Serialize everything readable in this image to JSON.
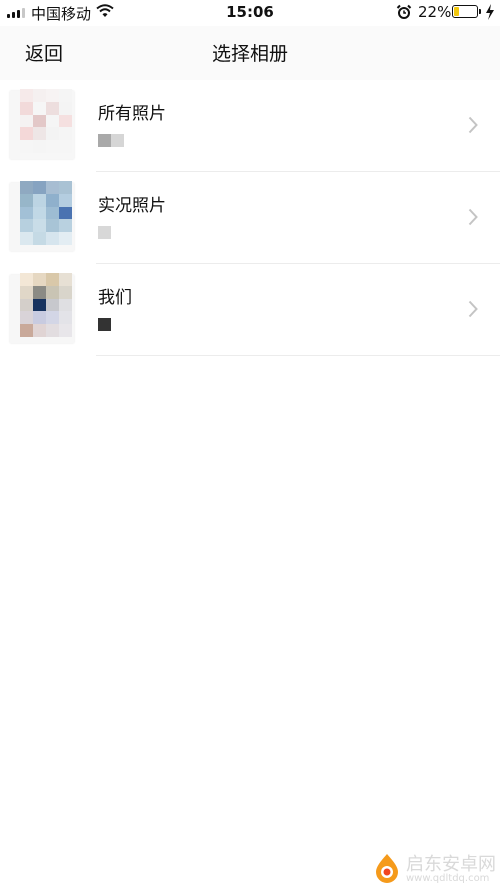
{
  "status_bar": {
    "carrier": "中国移动",
    "time": "15:06",
    "battery_percent": "22%",
    "battery_level": 0.22,
    "battery_color": "#f2c80f",
    "icons": [
      "signal-icon",
      "wifi-icon",
      "alarm-icon",
      "battery-icon",
      "charging-icon"
    ]
  },
  "nav": {
    "back_label": "返回",
    "title": "选择相册"
  },
  "albums": [
    {
      "name": "所有照片",
      "tiles": [
        "#f6eaea",
        "#f5f0f0",
        "#f7f3f3",
        "#f5f5f5",
        "#f2dada",
        "#f6f6f6",
        "#eddede",
        "#f4f4f4",
        "#f5f2f2",
        "#e3c8c8",
        "#f5f5f5",
        "#f5e0e0",
        "#f4d8d8",
        "#eee6e6",
        "#f3f3f3",
        "#f5f5f5",
        "#f6f6f6",
        "#f5f5f5",
        "#f6f6f6",
        "#f6f6f6"
      ],
      "count_tiles": [
        "#a9a9a9",
        "#d6d6d6"
      ]
    },
    {
      "name": "实况照片",
      "tiles": [
        "#8fa9c1",
        "#86a3c1",
        "#a7bdd2",
        "#a9c2d4",
        "#97b6c9",
        "#bcd4e3",
        "#8fb0cc",
        "#b4cde0",
        "#a2c0d6",
        "#c1d8e6",
        "#9dbcd3",
        "#4a73b1",
        "#b7d0df",
        "#c9dde8",
        "#a8c4d6",
        "#b9d1e0",
        "#dbe8ef",
        "#c5dae5",
        "#d6e5ee",
        "#e3edf3"
      ],
      "count_tiles": [
        "#d8d8d8"
      ]
    },
    {
      "name": "我们",
      "tiles": [
        "#f3e7d6",
        "#e6d8c2",
        "#d9c8a9",
        "#e7e0d4",
        "#e0d7c8",
        "#8b8b85",
        "#c9c4b4",
        "#d9d5cb",
        "#d4cfca",
        "#17335f",
        "#c7c8cd",
        "#dfdfe2",
        "#d9d3d8",
        "#c8cbe0",
        "#d3d6e6",
        "#e3e3e8",
        "#c9a99a",
        "#e0d4d4",
        "#e2dde0",
        "#e8e6ea"
      ],
      "count_tiles": [
        "#333333"
      ]
    }
  ],
  "watermark": {
    "title": "启东安卓网",
    "url": "www.qdltdq.com"
  }
}
